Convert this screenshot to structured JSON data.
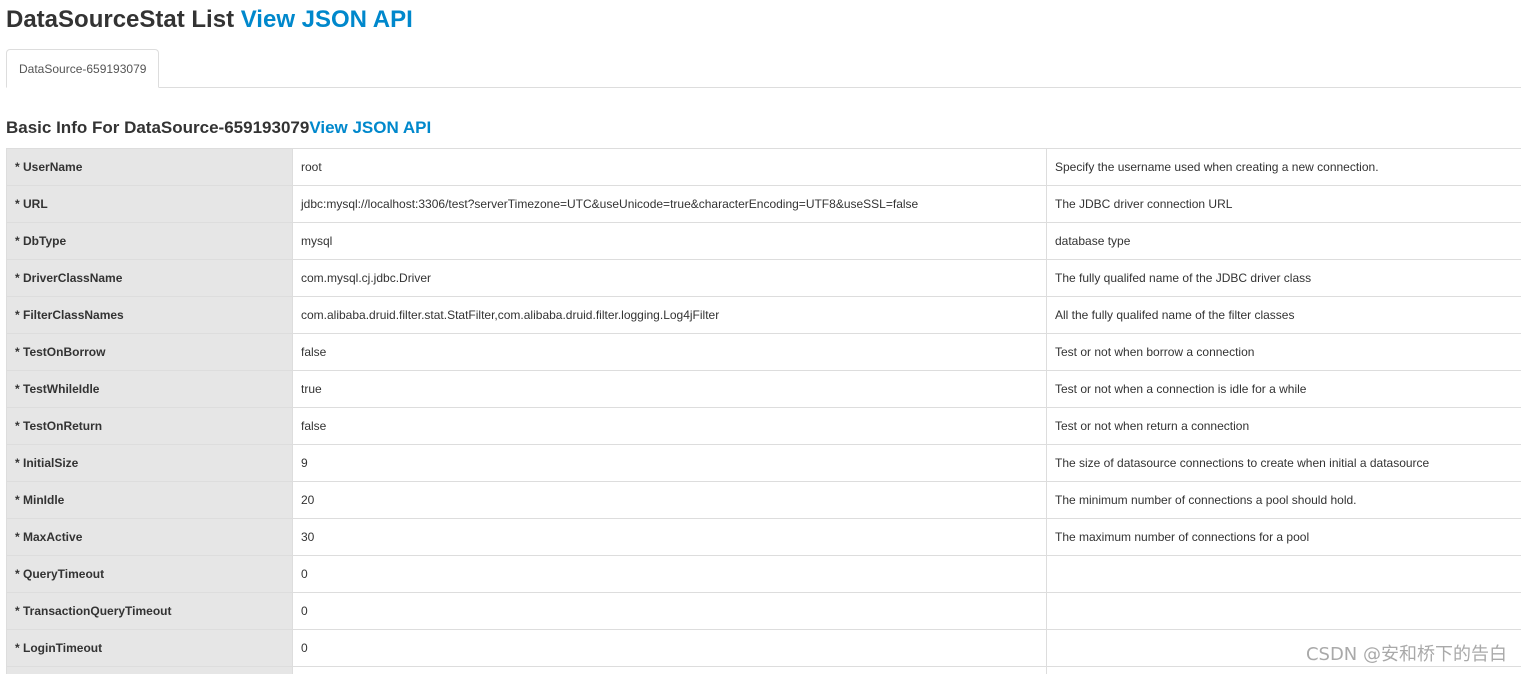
{
  "header": {
    "title": "DataSourceStat List",
    "json_link": "View JSON API"
  },
  "tabs": [
    {
      "label": "DataSource-659193079",
      "active": true
    }
  ],
  "section": {
    "title_prefix": "Basic Info For DataSource-659193079",
    "json_link": "View JSON API"
  },
  "rows": [
    {
      "key": "* UserName",
      "value": "root",
      "desc": "Specify the username used when creating a new connection."
    },
    {
      "key": "* URL",
      "value": "jdbc:mysql://localhost:3306/test?serverTimezone=UTC&useUnicode=true&characterEncoding=UTF8&useSSL=false",
      "desc": "The JDBC driver connection URL"
    },
    {
      "key": "* DbType",
      "value": "mysql",
      "desc": "database type"
    },
    {
      "key": "* DriverClassName",
      "value": "com.mysql.cj.jdbc.Driver",
      "desc": "The fully qualifed name of the JDBC driver class"
    },
    {
      "key": "* FilterClassNames",
      "value": "com.alibaba.druid.filter.stat.StatFilter,com.alibaba.druid.filter.logging.Log4jFilter",
      "desc": "All the fully qualifed name of the filter classes"
    },
    {
      "key": "* TestOnBorrow",
      "value": "false",
      "desc": "Test or not when borrow a connection"
    },
    {
      "key": "* TestWhileIdle",
      "value": "true",
      "desc": "Test or not when a connection is idle for a while"
    },
    {
      "key": "* TestOnReturn",
      "value": "false",
      "desc": "Test or not when return a connection"
    },
    {
      "key": "* InitialSize",
      "value": "9",
      "desc": "The size of datasource connections to create when initial a datasource"
    },
    {
      "key": "* MinIdle",
      "value": "20",
      "desc": "The minimum number of connections a pool should hold."
    },
    {
      "key": "* MaxActive",
      "value": "30",
      "desc": "The maximum number of connections for a pool"
    },
    {
      "key": "* QueryTimeout",
      "value": "0",
      "desc": ""
    },
    {
      "key": "* TransactionQueryTimeout",
      "value": "0",
      "desc": ""
    },
    {
      "key": "* LoginTimeout",
      "value": "0",
      "desc": ""
    },
    {
      "key": "",
      "value": "",
      "desc": ""
    }
  ],
  "watermark": "CSDN @安和桥下的告白",
  "colors": {
    "link": "#0088cc",
    "key_cell_bg": "#e6e6e6",
    "border": "#dddddd",
    "text": "#333333"
  }
}
